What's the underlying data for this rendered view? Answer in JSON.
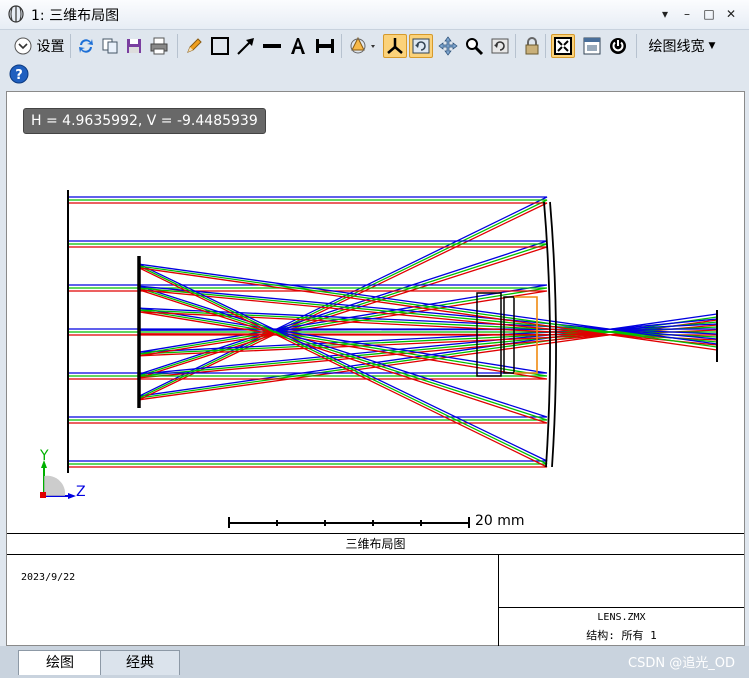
{
  "window": {
    "title": "1: 三维布局图",
    "controls": [
      "▾",
      "–",
      "□",
      "✕"
    ]
  },
  "toolbar": {
    "settings_label": "设置",
    "line_width_label": "绘图线宽",
    "icons": [
      "refresh-icon",
      "copy-icon",
      "save-icon",
      "print-icon",
      "pencil-icon",
      "rectangle-icon",
      "arrow-icon",
      "line-icon",
      "text-icon",
      "dimension-icon",
      "rotate-3d-icon",
      "axes-icon",
      "redraw-icon",
      "pan-icon",
      "zoom-icon",
      "reset-icon",
      "lock-icon",
      "fit-icon",
      "window-icon",
      "power-icon",
      "help-icon"
    ]
  },
  "plot": {
    "readout": "H = 4.9635992, V = -9.4485939",
    "scale_label": "20 mm",
    "axis_labels": {
      "y": "Y",
      "z": "Z"
    },
    "ray_colors": {
      "blue": "#0000e0",
      "green": "#00c000",
      "red": "#e00000"
    }
  },
  "info": {
    "title": "三维布局图",
    "date": "2023/9/22",
    "file": "LENS.ZMX",
    "config": "结构: 所有 1"
  },
  "tabs": [
    {
      "label": "绘图"
    },
    {
      "label": "经典"
    }
  ],
  "watermark": "CSDN @追光_OD"
}
